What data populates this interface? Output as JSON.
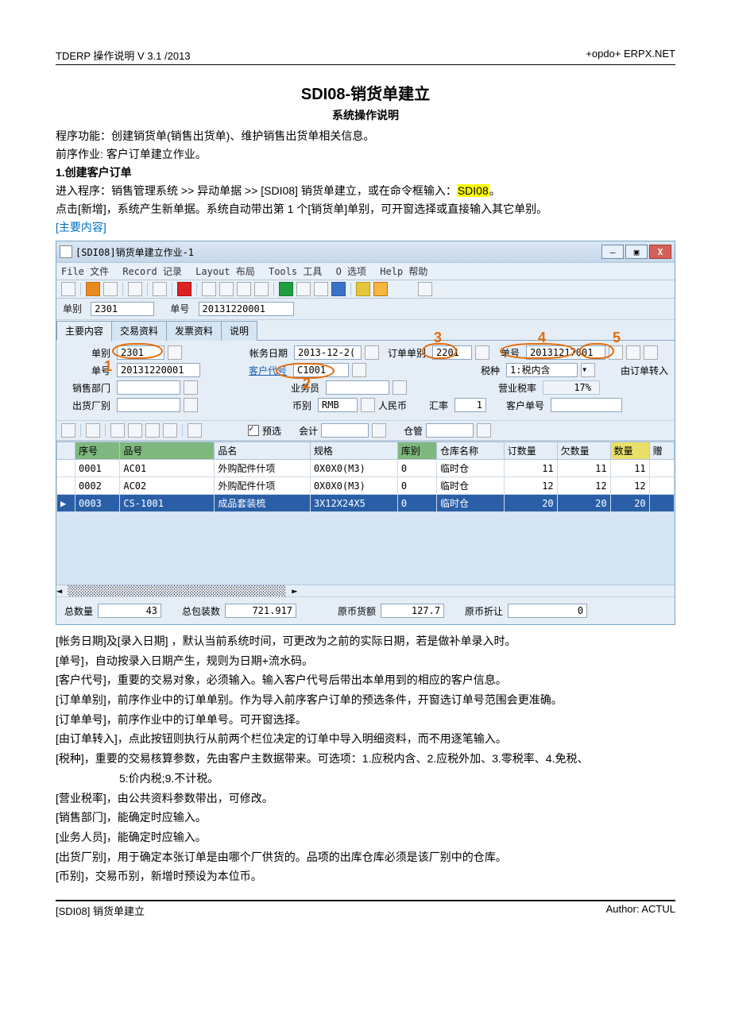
{
  "doc": {
    "header_left": "TDERP 操作说明  V 3.1 /2013",
    "header_right": "+opdo+ ERPX.NET",
    "title": "SDI08-销货单建立",
    "subtitle": "系统操作说明",
    "intro1": "程序功能：创建销货单(销售出货单)、维护销售出货单相关信息。",
    "intro2": "前序作业: 客户订单建立作业。",
    "step_title": "1.创建客户订单",
    "intro3a": "进入程序：销售管理系统 >> 异动单据 >> [SDI08] 销货单建立，或在命令框输入：",
    "intro3_cmd": "SDI08",
    "intro3b": "。",
    "intro4": "点击[新增]，系统产生新单据。系统自动带出第 1 个[销货单]单别，可开窗选择或直接输入其它单别。",
    "main_content": "[主要内容]"
  },
  "window": {
    "title": "[SDI08]销货单建立作业-1",
    "menus": [
      "File 文件",
      "Record 记录",
      "Layout 布局",
      "Tools 工具",
      "O 选项",
      "Help 帮助"
    ],
    "hdr_type_label": "单别",
    "hdr_type_value": "2301",
    "hdr_no_label": "单号",
    "hdr_no_value": "20131220001",
    "tabs": [
      "主要内容",
      "交易资料",
      "发票资料",
      "说明"
    ],
    "form": {
      "type_label": "单别",
      "type_val": "2301",
      "date_label": "帐务日期",
      "date_val": "2013-12-2(",
      "order_type_label": "订单单别",
      "order_type_val": "2201",
      "order_no_label": "单号",
      "order_no_val": "20131217001",
      "no_label": "单号",
      "no_val": "20131220001",
      "cust_label": "客户代号",
      "cust_val": "C1001",
      "tax_label": "税种",
      "tax_val": "1:税内含",
      "import_btn": "由订单转入",
      "dept_label": "销售部门",
      "sales_label": "业务员",
      "taxrate_label": "营业税率",
      "taxrate_val": "17%",
      "factory_label": "出货厂别",
      "curr_label": "币别",
      "curr_val": "RMB",
      "curr_name": "人民币",
      "rate_label": "汇率",
      "rate_val": "1",
      "custno_label": "客户单号",
      "preselect": "预选",
      "account": "会计",
      "keeper": "仓管"
    },
    "cols": [
      "序号",
      "品号",
      "品名",
      "规格",
      "库别",
      "仓库名称",
      "订数量",
      "欠数量",
      "数量",
      "赠"
    ],
    "rows": [
      {
        "seq": "0001",
        "code": "AC01",
        "name": "外购配件什项",
        "spec": "0X0X0(M3)",
        "loc": "0",
        "locname": "临时仓",
        "ord": "11",
        "owe": "11",
        "qty": "11",
        "gift": ""
      },
      {
        "seq": "0002",
        "code": "AC02",
        "name": "外购配件什项",
        "spec": "0X0X0(M3)",
        "loc": "0",
        "locname": "临时仓",
        "ord": "12",
        "owe": "12",
        "qty": "12",
        "gift": ""
      },
      {
        "seq": "0003",
        "code": "CS-1001",
        "name": "成品套装梳",
        "spec": "3X12X24X5",
        "loc": "0",
        "locname": "临时仓",
        "ord": "20",
        "owe": "20",
        "qty": "20",
        "gift": ""
      }
    ],
    "totals": {
      "qty_label": "总数量",
      "qty": "43",
      "pack_label": "总包装数",
      "pack": "721.917",
      "amt_label": "原币货额",
      "amt": "127.7",
      "disc_label": "原币折让",
      "disc": "0"
    }
  },
  "notes": {
    "l1": "[帐务日期]及[录入日期] ，默认当前系统时间，可更改为之前的实际日期，若是做补单录入时。",
    "l2": "[单号]，自动按录入日期产生，规则为日期+流水码。",
    "l3": "[客户代号]，重要的交易对象，必须输入。输入客户代号后带出本单用到的相应的客户信息。",
    "l4": "[订单单别]，前序作业中的订单单别。作为导入前序客户订单的预选条件，开窗选订单号范围会更准确。",
    "l5": "[订单单号]，前序作业中的订单单号。可开窗选择。",
    "l6": "[由订单转入]，点此按钮则执行从前两个栏位决定的订单中导入明细资料，而不用逐笔输入。",
    "l7": "[税种]，重要的交易核算参数，先由客户主数据带来。可选项：1.应税内含、2.应税外加、3.零税率、4.免税、",
    "l7b": "5:价内税;9.不计税。",
    "l8": "[营业税率]，由公共资料参数带出，可修改。",
    "l9": "[销售部门]，能确定时应输入。",
    "l10": "[业务人员]，能确定时应输入。",
    "l11": "[出货厂别]，用于确定本张订单是由哪个厂供货的。品项的出库仓库必须是该厂别中的仓库。",
    "l12": "[币别]，交易币别，新增时预设为本位币。"
  },
  "footer": {
    "left": "[SDI08] 销货单建立",
    "right": "Author:  ACTUL"
  },
  "steps": {
    "s1": "1",
    "s2": "2",
    "s3": "3",
    "s4": "4",
    "s5": "5"
  }
}
